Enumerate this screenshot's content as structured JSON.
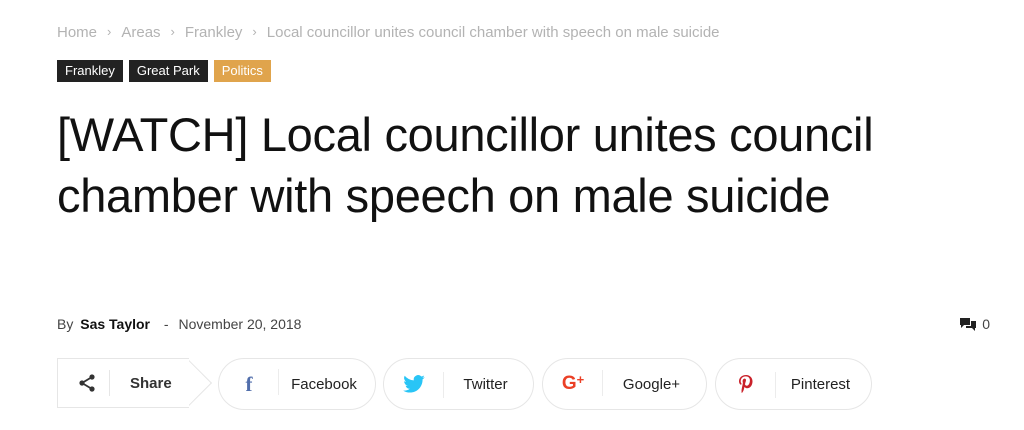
{
  "breadcrumb": {
    "items": [
      "Home",
      "Areas",
      "Frankley",
      "Local councillor unites council chamber with speech on male suicide"
    ],
    "separator": "›"
  },
  "tags": [
    {
      "label": "Frankley",
      "color": "#222222"
    },
    {
      "label": "Great Park",
      "color": "#222222"
    },
    {
      "label": "Politics",
      "color": "#e0a44c"
    }
  ],
  "article": {
    "title": "[WATCH] Local councillor unites council chamber with speech on male suicide",
    "by_label": "By",
    "author": "Sas Taylor",
    "dash": "-",
    "date": "November 20, 2018",
    "comment_count": "0",
    "comment_icon": "comments-icon"
  },
  "share": {
    "label": "Share",
    "icon": "share-icon",
    "buttons": [
      {
        "name": "Facebook",
        "icon": "facebook-icon",
        "color": "#516eab"
      },
      {
        "name": "Twitter",
        "icon": "twitter-icon",
        "color": "#29c5f6"
      },
      {
        "name": "Google+",
        "icon": "google-plus-icon",
        "color": "#eb4026"
      },
      {
        "name": "Pinterest",
        "icon": "pinterest-icon",
        "color": "#ca212a"
      }
    ]
  }
}
